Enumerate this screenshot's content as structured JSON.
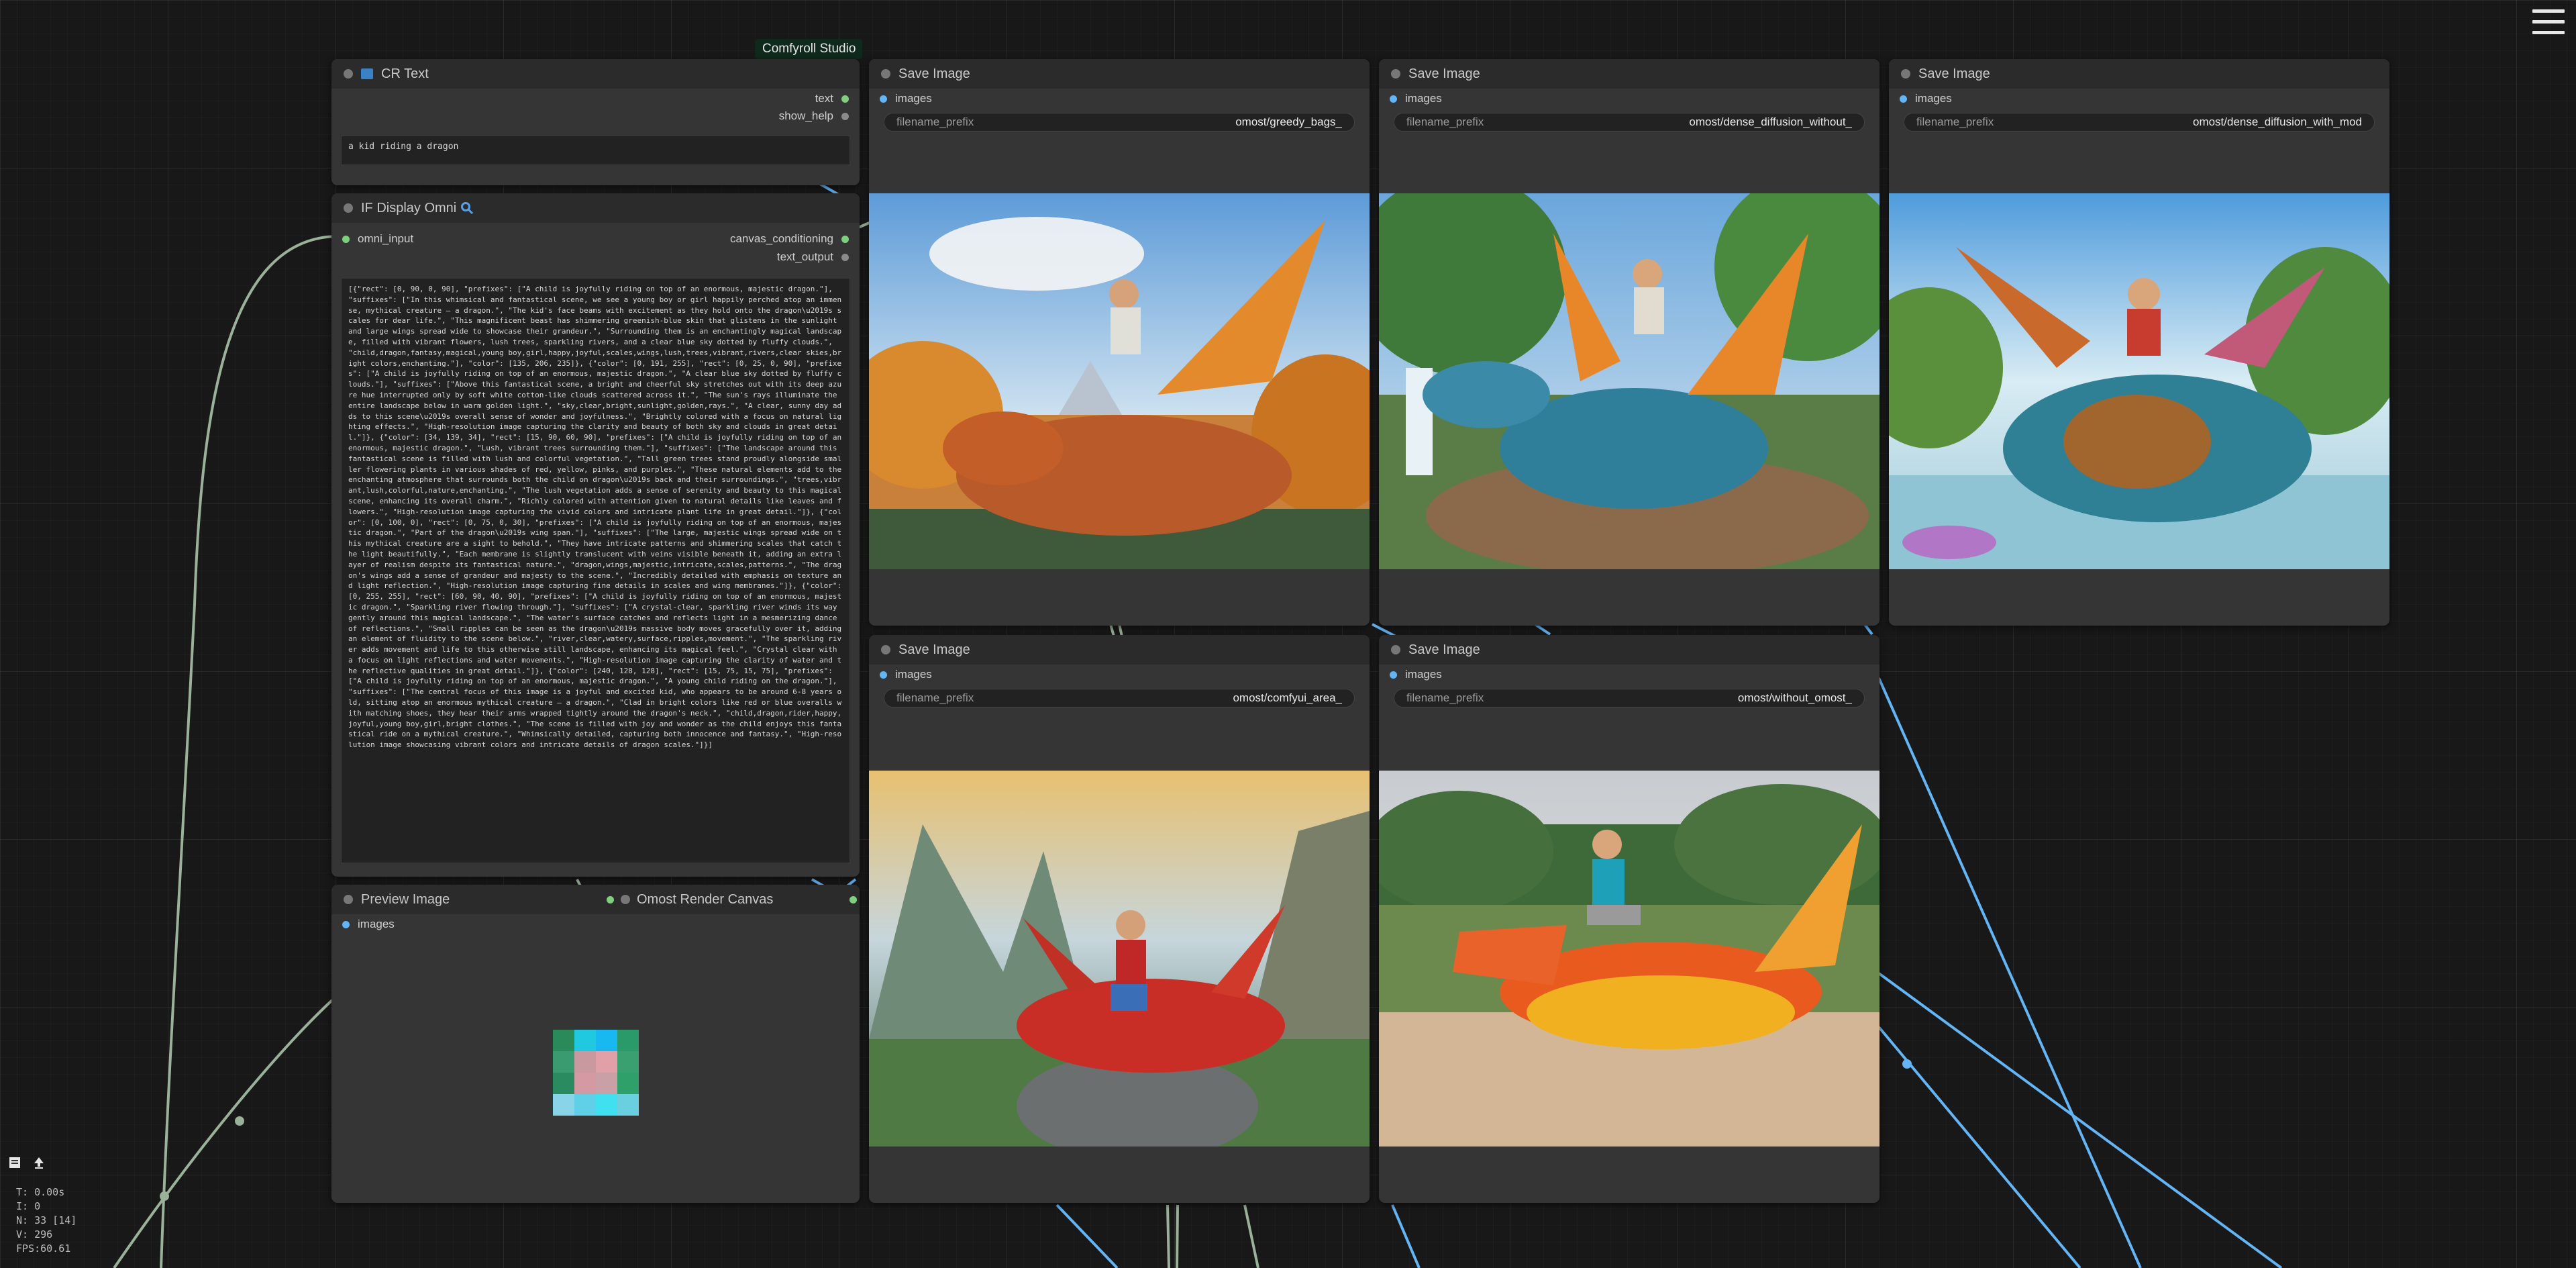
{
  "app": {
    "badge": "Comfyroll Studio"
  },
  "cr_text": {
    "title": "CR Text",
    "outputs": [
      "text",
      "show_help"
    ],
    "value": "a kid riding a dragon"
  },
  "display_omni": {
    "title": "IF Display Omni",
    "input": "omni_input",
    "outputs": [
      "canvas_conditioning",
      "text_output"
    ],
    "text": "[{\"rect\": [0, 90, 0, 90], \"prefixes\": [\"A child is joyfully riding on top of an enormous, majestic dragon.\"], \"suffixes\": [\"In this whimsical and fantastical scene, we see a young boy or girl happily perched atop an immense, mythical creature – a dragon.\", \"The kid's face beams with excitement as they hold onto the dragon\\u2019s scales for dear life.\", \"This magnificent beast has shimmering greenish-blue skin that glistens in the sunlight and large wings spread wide to showcase their grandeur.\", \"Surrounding them is an enchantingly magical landscape, filled with vibrant flowers, lush trees, sparkling rivers, and a clear blue sky dotted by fluffy clouds.\", \"child,dragon,fantasy,magical,young boy,girl,happy,joyful,scales,wings,lush,trees,vibrant,rivers,clear skies,bright colors,enchanting.\"], \"color\": [135, 206, 235]}, {\"color\": [0, 191, 255], \"rect\": [0, 25, 0, 90], \"prefixes\": [\"A child is joyfully riding on top of an enormous, majestic dragon.\", \"A clear blue sky dotted by fluffy clouds.\"], \"suffixes\": [\"Above this fantastical scene, a bright and cheerful sky stretches out with its deep azure hue interrupted only by soft white cotton-like clouds scattered across it.\", \"The sun's rays illuminate the entire landscape below in warm golden light.\", \"sky,clear,bright,sunlight,golden,rays.\", \"A clear, sunny day adds to this scene\\u2019s overall sense of wonder and joyfulness.\", \"Brightly colored with a focus on natural lighting effects.\", \"High-resolution image capturing the clarity and beauty of both sky and clouds in great detail.\"]}, {\"color\": [34, 139, 34], \"rect\": [15, 90, 60, 90], \"prefixes\": [\"A child is joyfully riding on top of an enormous, majestic dragon.\", \"Lush, vibrant trees surrounding them.\"], \"suffixes\": [\"The landscape around this fantastical scene is filled with lush and colorful vegetation.\", \"Tall green trees stand proudly alongside smaller flowering plants in various shades of red, yellow, pinks, and purples.\", \"These natural elements add to the enchanting atmosphere that surrounds both the child on dragon\\u2019s back and their surroundings.\", \"trees,vibrant,lush,colorful,nature,enchanting.\", \"The lush vegetation adds a sense of serenity and beauty to this magical scene, enhancing its overall charm.\", \"Richly colored with attention given to natural details like leaves and flowers.\", \"High-resolution image capturing the vivid colors and intricate plant life in great detail.\"]}, {\"color\": [0, 100, 0], \"rect\": [0, 75, 0, 30], \"prefixes\": [\"A child is joyfully riding on top of an enormous, majestic dragon.\", \"Part of the dragon\\u2019s wing span.\"], \"suffixes\": [\"The large, majestic wings spread wide on this mythical creature are a sight to behold.\", \"They have intricate patterns and shimmering scales that catch the light beautifully.\", \"Each membrane is slightly translucent with veins visible beneath it, adding an extra layer of realism despite its fantastical nature.\", \"dragon,wings,majestic,intricate,scales,patterns.\", \"The dragon's wings add a sense of grandeur and majesty to the scene.\", \"Incredibly detailed with emphasis on texture and light reflection.\", \"High-resolution image capturing fine details in scales and wing membranes.\"]}, {\"color\": [0, 255, 255], \"rect\": [60, 90, 40, 90], \"prefixes\": [\"A child is joyfully riding on top of an enormous, majestic dragon.\", \"Sparkling river flowing through.\"], \"suffixes\": [\"A crystal-clear, sparkling river winds its way gently around this magical landscape.\", \"The water's surface catches and reflects light in a mesmerizing dance of reflections.\", \"Small ripples can be seen as the dragon\\u2019s massive body moves gracefully over it, adding an element of fluidity to the scene below.\", \"river,clear,watery,surface,ripples,movement.\", \"The sparkling river adds movement and life to this otherwise still landscape, enhancing its magical feel.\", \"Crystal clear with a focus on light reflections and water movements.\", \"High-resolution image capturing the clarity of water and the reflective qualities in great detail.\"]}, {\"color\": [240, 128, 128], \"rect\": [15, 75, 15, 75], \"prefixes\": [\"A child is joyfully riding on top of an enormous, majestic dragon.\", \"A young child riding on the dragon.\"], \"suffixes\": [\"The central focus of this image is a joyful and excited kid, who appears to be around 6-8 years old, sitting atop an enormous mythical creature – a dragon.\", \"Clad in bright colors like red or blue overalls with matching shoes, they hear their arms wrapped tightly around the dragon's neck.\", \"child,dragon,rider,happy,joyful,young boy,girl,bright clothes.\", \"The scene is filled with joy and wonder as the child enjoys this fantastical ride on a mythical creature.\", \"Whimsically detailed, capturing both innocence and fantasy.\", \"High-resolution image showcasing vibrant colors and intricate details of dragon scales.\"]}]"
  },
  "save_nodes": [
    {
      "title": "Save Image",
      "input": "images",
      "widget_label": "filename_prefix",
      "widget_value": "omost/greedy_bags_"
    },
    {
      "title": "Save Image",
      "input": "images",
      "widget_label": "filename_prefix",
      "widget_value": "omost/dense_diffusion_without_"
    },
    {
      "title": "Save Image",
      "input": "images",
      "widget_label": "filename_prefix",
      "widget_value": "omost/dense_diffusion_with_mod"
    },
    {
      "title": "Save Image",
      "input": "images",
      "widget_label": "filename_prefix",
      "widget_value": "omost/comfyui_area_"
    },
    {
      "title": "Save Image",
      "input": "images",
      "widget_label": "filename_prefix",
      "widget_value": "omost/without_omost_"
    }
  ],
  "preview": {
    "title": "Preview Image",
    "input": "images"
  },
  "render_canvas": {
    "title": "Omost Render Canvas"
  },
  "stats": {
    "t": "T: 0.00s",
    "i": "I: 0",
    "n": "N: 33 [14]",
    "v": "V: 296",
    "fps": "FPS:60.61"
  },
  "icons": [
    "hamburger-menu-icon",
    "magnifier-icon",
    "node-type-icon",
    "image-icon",
    "upload-icon"
  ],
  "colors": {
    "background": "#181818",
    "node": "#353535",
    "title_bar": "#2b2b2b",
    "wire_image": "#64b5f6",
    "wire_green": "#9bc59b",
    "slot_green": "#7ed07e",
    "badge": "#0f2a1c"
  }
}
